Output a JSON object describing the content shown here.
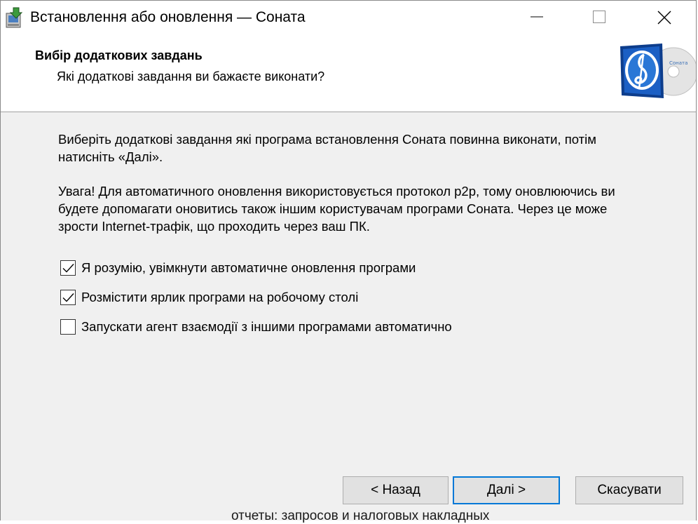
{
  "window": {
    "title": "Встановлення або оновлення — Соната"
  },
  "header": {
    "title": "Вибір додаткових завдань",
    "subtitle": "Які додаткові завдання ви бажаєте виконати?",
    "logo_text": "Соната"
  },
  "body": {
    "intro": "Виберіть додаткові завдання які програма встановлення Соната повинна виконати, потім натисніть «Далі».",
    "warning": "Увага! Для автоматичного оновлення використовується протокол p2p, тому оновлюючись ви будете допомагати оновитись також іншим користувачам програми Соната. Через це може зрости Internet-трафік, що проходить через ваш ПК."
  },
  "options": [
    {
      "label": "Я розумію, увімкнути автоматичне оновлення програми",
      "checked": true
    },
    {
      "label": "Розмістити ярлик програми на робочому столі",
      "checked": true
    },
    {
      "label": "Запускати агент взаємодії з іншими програмами автоматично",
      "checked": false
    }
  ],
  "buttons": {
    "back": "< Назад",
    "next": "Далі >",
    "cancel": "Скасувати"
  },
  "background_text": "отчеты: запросов и налоговых накладных",
  "colors": {
    "accent": "#0078d7",
    "dialog_bg": "#f0f0f0"
  }
}
